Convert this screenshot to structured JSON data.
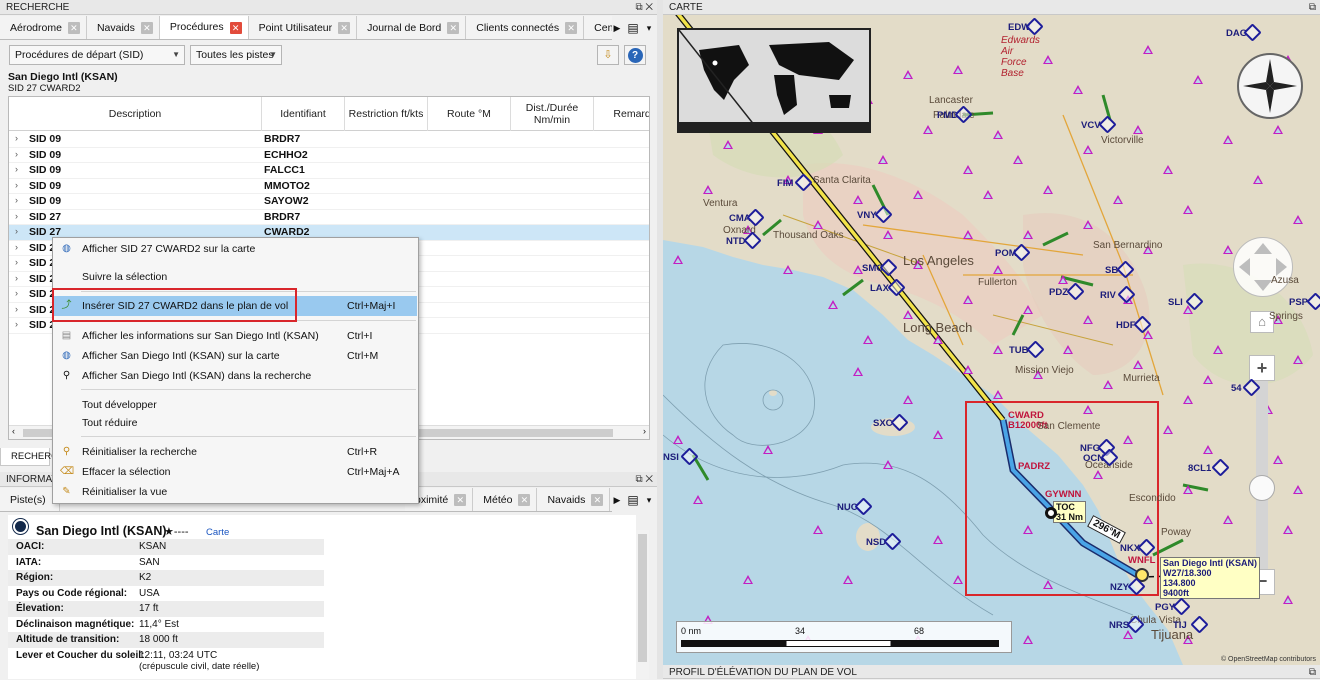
{
  "search_panel": {
    "title": "RECHERCHE",
    "tabs": [
      "Aérodrome",
      "Navaids",
      "Procédures",
      "Point Utilisateur",
      "Journal de Bord",
      "Clients connectés",
      "Centres con"
    ],
    "active_tab": "Procédures",
    "proc_type": "Procédures de départ (SID)",
    "runway_filter": "Toutes les pistes",
    "airport": "San Diego Intl (KSAN)",
    "procedure": "SID 27 CWARD2",
    "columns": [
      "Description",
      "Identifiant",
      "Restriction ft/kts",
      "Route °M",
      "Dist./Durée Nm/min",
      "Remarqu"
    ],
    "rows": [
      {
        "desc": "SID 09",
        "ident": "BRDR7"
      },
      {
        "desc": "SID 09",
        "ident": "ECHHO2"
      },
      {
        "desc": "SID 09",
        "ident": "FALCC1"
      },
      {
        "desc": "SID 09",
        "ident": "MMOTO2"
      },
      {
        "desc": "SID 09",
        "ident": "SAYOW2"
      },
      {
        "desc": "SID 27",
        "ident": "BRDR7"
      },
      {
        "desc": "SID 27",
        "ident": "CWARD2"
      },
      {
        "desc": "SID 2",
        "ident": ""
      },
      {
        "desc": "SID 2",
        "ident": ""
      },
      {
        "desc": "SID 2",
        "ident": ""
      },
      {
        "desc": "SID 2",
        "ident": ""
      },
      {
        "desc": "SID 2",
        "ident": ""
      },
      {
        "desc": "SID 2",
        "ident": ""
      }
    ],
    "bottom_tab": "RECHERCH"
  },
  "context_menu": {
    "items": [
      {
        "label": "Afficher  SID 27  CWARD2 sur la carte",
        "shortcut": "",
        "icon": "globe-icon"
      },
      {
        "label": "Suivre la sélection",
        "shortcut": "",
        "icon": ""
      },
      {
        "label": "Insérer  SID 27  CWARD2 dans le plan de vol",
        "shortcut": "Ctrl+Maj+I",
        "icon": "route-insert-icon"
      },
      {
        "label": "Afficher les informations sur San Diego Intl (KSAN)",
        "shortcut": "Ctrl+I",
        "icon": "info-icon"
      },
      {
        "label": "Afficher San Diego Intl (KSAN) sur la carte",
        "shortcut": "Ctrl+M",
        "icon": "globe-icon"
      },
      {
        "label": "Afficher San Diego Intl (KSAN) dans la recherche",
        "shortcut": "",
        "icon": "search-icon"
      },
      {
        "label": "Tout développer",
        "shortcut": "",
        "icon": ""
      },
      {
        "label": "Tout réduire",
        "shortcut": "",
        "icon": ""
      },
      {
        "label": "Réinitialiser la recherche",
        "shortcut": "Ctrl+R",
        "icon": "reset-search-icon"
      },
      {
        "label": "Effacer la sélection",
        "shortcut": "Ctrl+Maj+A",
        "icon": "eraser-icon"
      },
      {
        "label": "Réinitialiser la vue",
        "shortcut": "",
        "icon": "reset-view-icon"
      }
    ]
  },
  "info_panel": {
    "title": "INFORMAT",
    "tabs": [
      "Piste(s)",
      "oximité",
      "Météo",
      "Navaids"
    ],
    "airport_title": "San Diego Intl (KSAN)",
    "rating": "★----",
    "map_link": "Carte",
    "fields": [
      {
        "k": "OACI:",
        "v": "KSAN"
      },
      {
        "k": "IATA:",
        "v": "SAN"
      },
      {
        "k": "Région:",
        "v": "K2"
      },
      {
        "k": "Pays ou Code régional:",
        "v": "USA"
      },
      {
        "k": "Élevation:",
        "v": "17 ft"
      },
      {
        "k": "Déclinaison magnétique:",
        "v": "11,4° Est"
      },
      {
        "k": "Altitude de transition:",
        "v": "18 000 ft"
      },
      {
        "k": "Lever et Coucher du soleil:",
        "v": "12:11, 03:24 UTC"
      }
    ],
    "sun_note": "(crépuscule civil, date réelle)"
  },
  "map_panel": {
    "title": "CARTE",
    "bottom_title": "PROFIL D'ÉLÉVATION DU PLAN DE VOL",
    "scale": [
      "0 nm",
      "34",
      "68"
    ],
    "credit": "© OpenStreetMap contributors",
    "places": [
      "Edwards Air Force Base",
      "Lancaster",
      "Palmdale",
      "Victorville",
      "Santa Clarita",
      "Ventura",
      "Oxnard",
      "Thousand Oaks",
      "Los Angeles",
      "Long Beach",
      "San Bernardino",
      "Fullerton",
      "Mission Viejo",
      "Murrieta",
      "San Clemente",
      "Oceanside",
      "Escondido",
      "Poway",
      "Chula Vista",
      "Tijuana",
      "Springs",
      "Azusa"
    ],
    "navaids": [
      "EDW",
      "DAG",
      "PMD",
      "VCV",
      "FIM",
      "CMA",
      "NTD",
      "VNY",
      "SMO",
      "LAX",
      "POM",
      "PDZ",
      "RIV",
      "HDF",
      "SB",
      "SLI",
      "TUB",
      "PSP",
      "SXC",
      "NUC",
      "NSD",
      "NSI",
      "NFG",
      "OCN",
      "NKX",
      "NZY",
      "NRS",
      "PGY",
      "TIJ",
      "8CL1",
      "54"
    ],
    "route_points": [
      {
        "name": "CWARD",
        "alt": "B12000ft"
      },
      {
        "name": "PADRZ",
        "alt": ""
      },
      {
        "name": "GYWNN",
        "alt": ""
      },
      {
        "name": "TOC",
        "alt": "31 Nm"
      },
      {
        "name": "WNFL",
        "alt": ""
      }
    ],
    "track_label": "296°M",
    "airport_label": "San Diego Intl (KSAN)",
    "airport_freq1": "W27/18.300",
    "airport_freq2": "134.800",
    "airport_extra": "9400ft"
  }
}
